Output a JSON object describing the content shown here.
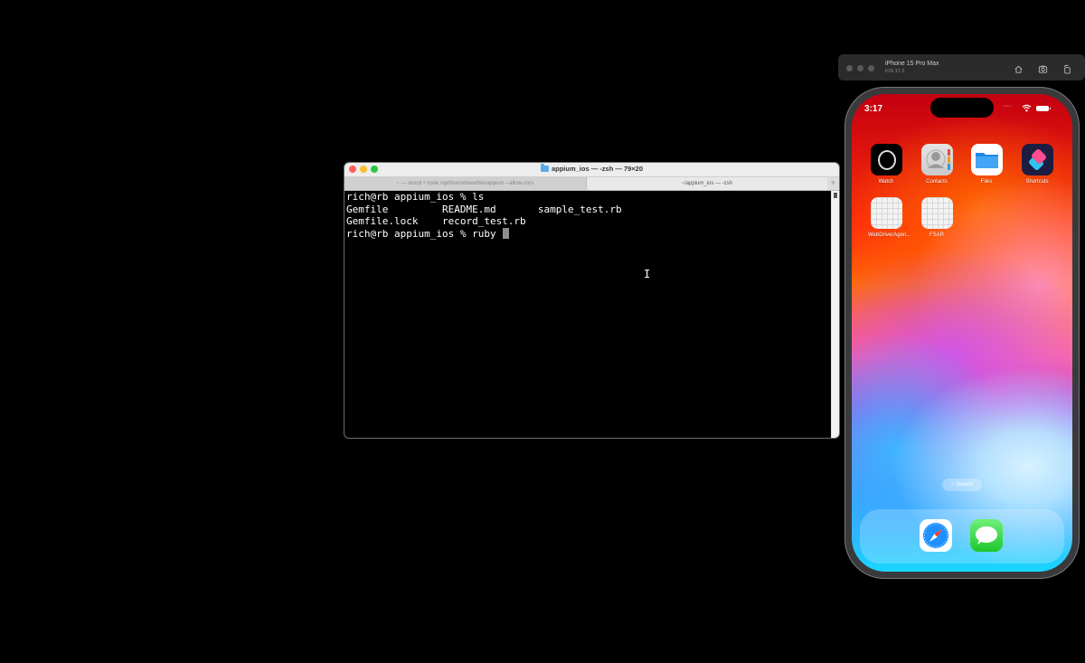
{
  "terminal": {
    "title": "appium_ios — -zsh — 79×20",
    "tabs": [
      {
        "label": "~ — simctl • node /opt/homebrew/bin/appium --allow-cors",
        "active": false
      },
      {
        "label": "~/appium_ios — -zsh",
        "active": true
      }
    ],
    "new_tab_label": "+",
    "lines": [
      "rich@rb appium_ios % ls",
      "Gemfile         README.md       sample_test.rb",
      "Gemfile.lock    record_test.rb",
      "rich@rb appium_ios % ruby "
    ]
  },
  "simulator": {
    "device_name": "iPhone 15 Pro Max",
    "os_version": "iOS 17.2",
    "toolbar_icons": [
      "home-icon",
      "screenshot-icon",
      "rotate-icon"
    ],
    "status_bar": {
      "time": "3:17",
      "signal": "····"
    },
    "apps": [
      {
        "label": "Watch",
        "icon": "watch-icon"
      },
      {
        "label": "Contacts",
        "icon": "contacts-icon"
      },
      {
        "label": "Files",
        "icon": "files-icon"
      },
      {
        "label": "Shortcuts",
        "icon": "shortcuts-icon"
      },
      {
        "label": "WebDriverAgen...",
        "icon": "placeholder-app-icon"
      },
      {
        "label": "FSAR",
        "icon": "placeholder-app-icon"
      }
    ],
    "search_label": "Search",
    "dock": [
      "safari-icon",
      "messages-icon"
    ]
  }
}
